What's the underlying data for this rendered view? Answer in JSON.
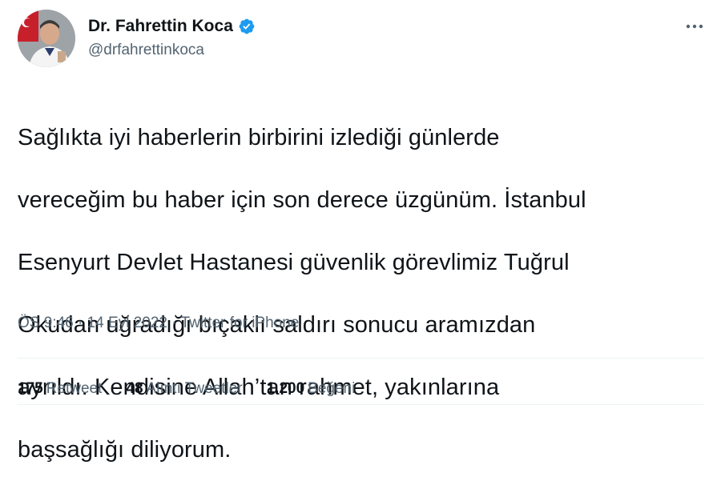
{
  "author": {
    "display_name": "Dr. Fahrettin Koca",
    "handle": "@drfahrettinkoca",
    "verified": true
  },
  "tweet": {
    "lines": [
      "Sağlıkta iyi haberlerin birbirini izlediği günlerde",
      "vereceğim bu haber için son derece üzgünüm. İstanbul",
      "Esenyurt Devlet Hastanesi güvenlik görevlimiz Tuğrul",
      "Okudan uğradığı bıçaklı saldırı sonucu aramızdan",
      "ayrıldı. Kendisine Allah’tan rahmet, yakınlarına",
      "başsağlığı diliyorum."
    ]
  },
  "meta": {
    "time": "ÖS 9:46",
    "separator": "·",
    "date": "14 Eyl 2022",
    "source": "Twitter for iPhone"
  },
  "stats": {
    "retweets_count": "175",
    "retweets_label": "Retweet",
    "quotes_count": "48",
    "quotes_label": "Alıntı Tweetler",
    "likes_count": "1.200",
    "likes_label": "Beğeni"
  },
  "colors": {
    "text": "#0f1419",
    "secondary": "#536471",
    "verified": "#1d9bf0",
    "divider": "#eff3f4"
  },
  "icons": {
    "verified": "verified-badge-icon",
    "more": "more-options-icon"
  }
}
